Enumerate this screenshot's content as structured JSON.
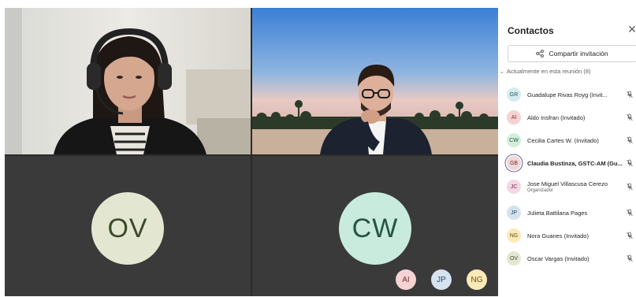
{
  "stage": {
    "tiles": [
      {
        "id": "tile-1",
        "type": "video"
      },
      {
        "id": "tile-2",
        "type": "video"
      },
      {
        "id": "tile-3",
        "type": "avatar",
        "initials": "OV",
        "bg": "#e3e7d2"
      },
      {
        "id": "tile-4",
        "type": "avatar",
        "initials": "CW",
        "bg": "#c8ebde"
      }
    ],
    "overflow": [
      {
        "initials": "AI",
        "bg": "#f5d3d3",
        "fg": "#7a2e2e"
      },
      {
        "initials": "JP",
        "bg": "#d6e2ee",
        "fg": "#2c4a66"
      },
      {
        "initials": "NG",
        "bg": "#fbe9b8",
        "fg": "#6b5118"
      }
    ]
  },
  "panel": {
    "title": "Contactos",
    "share_label": "Compartir invitación",
    "section_label": "Actualmente en esta reunión (8)",
    "people": [
      {
        "initials": "GR",
        "name": "Guadalupe Rivas Royg (Invit...",
        "bg": "#d4ecef",
        "fg": "#22545b",
        "bold": false,
        "role": ""
      },
      {
        "initials": "AI",
        "name": "Aldo Insfran (Invitado)",
        "bg": "#f5d3d3",
        "fg": "#7a2e2e",
        "bold": false,
        "role": ""
      },
      {
        "initials": "CW",
        "name": "Cecilia Cartes W. (Invitado)",
        "bg": "#d3eedd",
        "fg": "#245238",
        "bold": false,
        "role": ""
      },
      {
        "initials": "GB",
        "name": "Claudia Bustinza, GSTC-AM (Gu...",
        "bg": "#f0d6d6",
        "fg": "#6e3030",
        "bold": true,
        "ring": true,
        "role": ""
      },
      {
        "initials": "JC",
        "name": "Jose Miguel Villascusa Cerezo",
        "bg": "#f4d7e4",
        "fg": "#6e2c4a",
        "bold": false,
        "role": "Organizador"
      },
      {
        "initials": "JP",
        "name": "Julieta Battilana Pages",
        "bg": "#d6e2ee",
        "fg": "#2c4a66",
        "bold": false,
        "role": ""
      },
      {
        "initials": "NG",
        "name": "Nora Guanes (Invitado)",
        "bg": "#fbe9b8",
        "fg": "#6b5118",
        "bold": false,
        "role": ""
      },
      {
        "initials": "OV",
        "name": "Oscar Vargas (Invitado)",
        "bg": "#e3e7d2",
        "fg": "#3c4a2a",
        "bold": false,
        "role": ""
      }
    ]
  }
}
